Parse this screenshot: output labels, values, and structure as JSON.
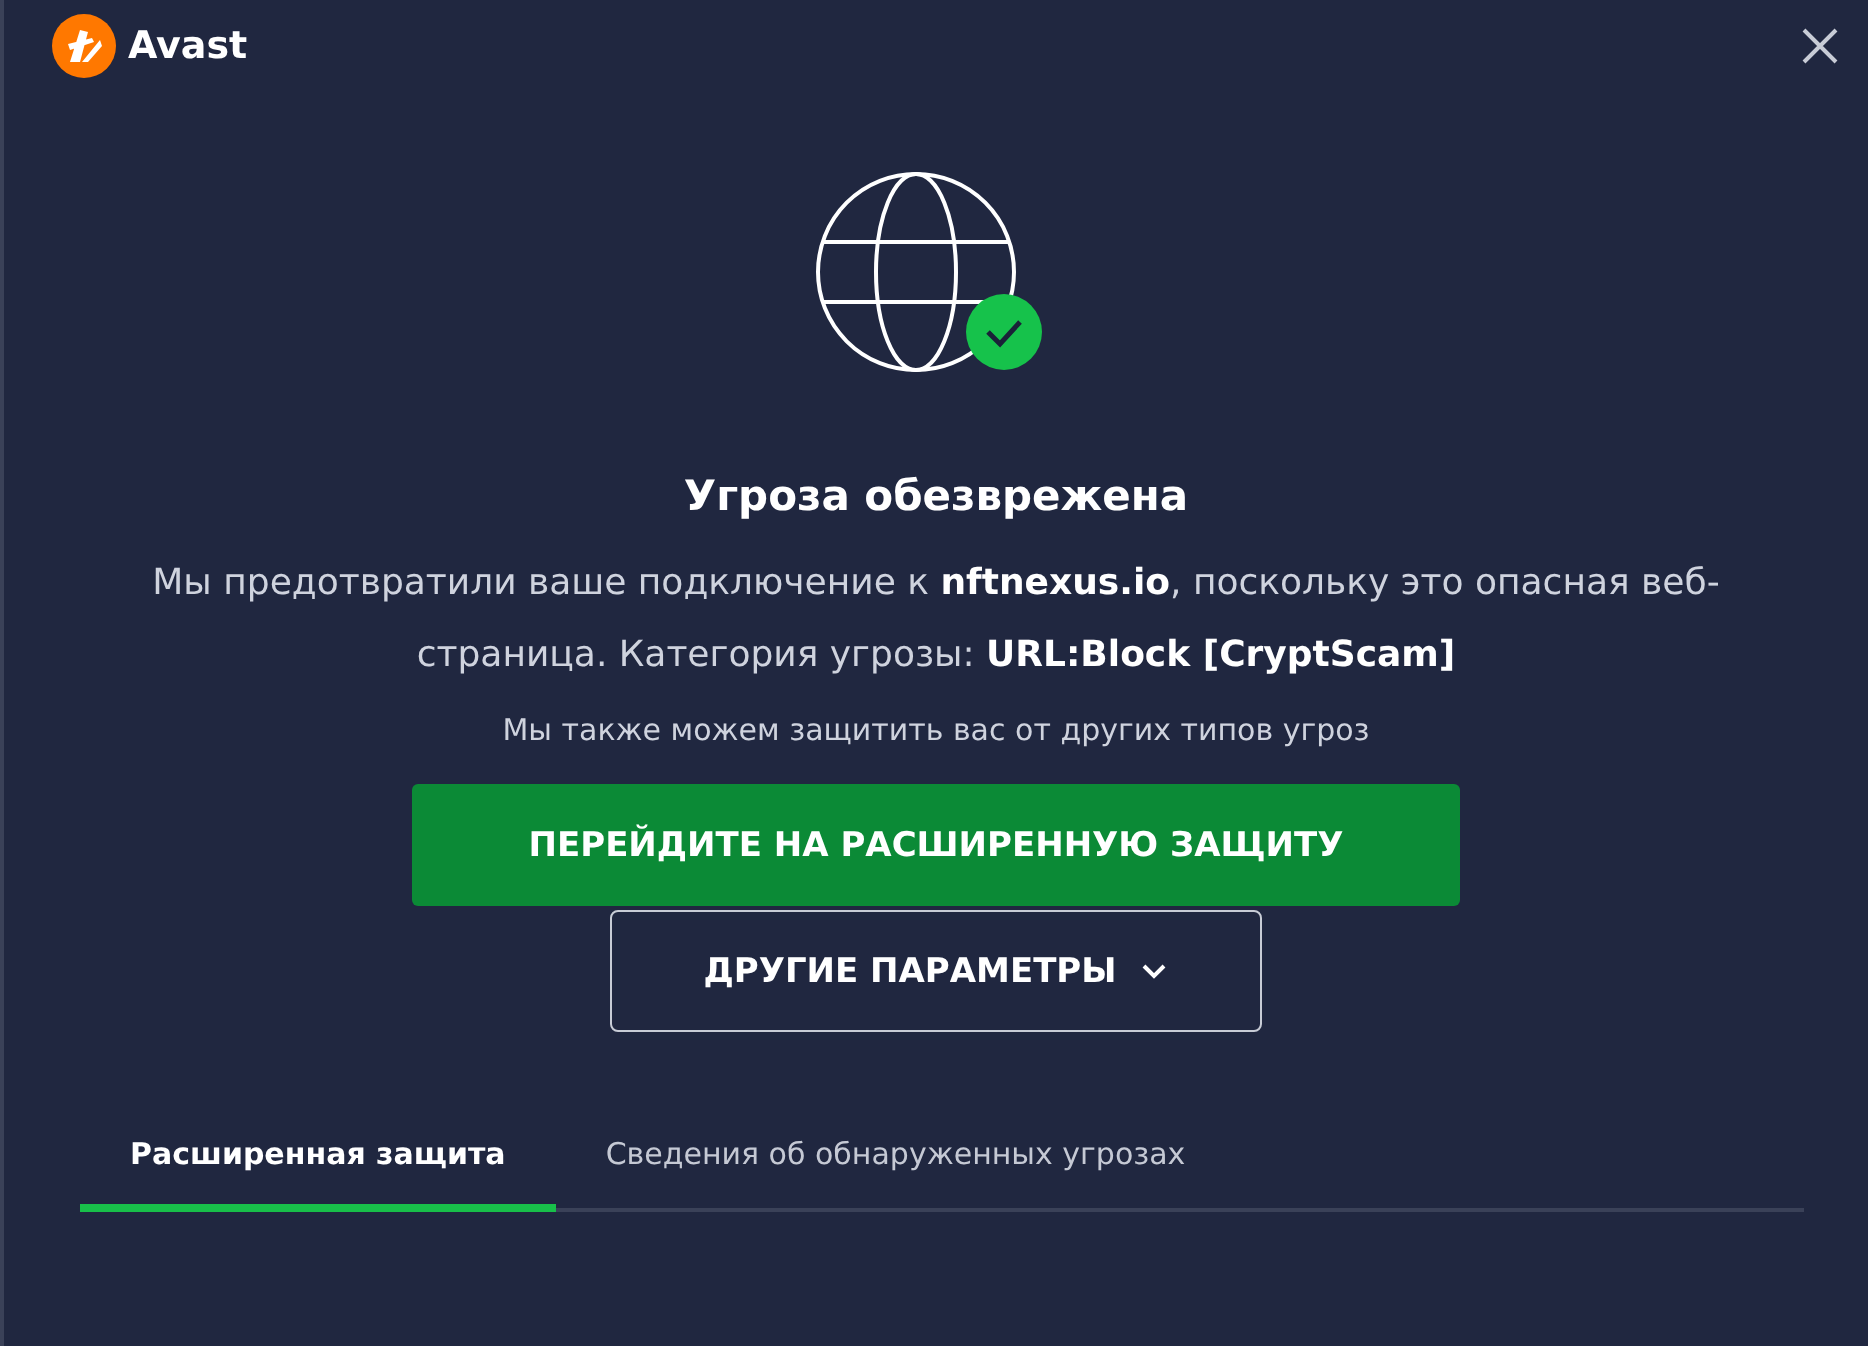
{
  "app": {
    "name": "Avast"
  },
  "title": "Угроза обезврежена",
  "message": "Мы предотвратили ваше подключение к **nftnexus.io**, поскольку это опасная веб-страница. Категория угрозы: **URL:Block [CryptScam]**",
  "note": "Мы также можем защитить вас от других типов угроз",
  "primary_button": "ПЕРЕЙДИТЕ НА РАСШИРЕННУЮ ЗАЩИТУ",
  "options_button": "ДРУГИЕ ПАРАМЕТРЫ",
  "tabs": [
    {
      "label": "Расширенная защита",
      "selected": true
    },
    {
      "label": "Сведения об обнаруженных угрозах",
      "selected": false
    }
  ]
}
